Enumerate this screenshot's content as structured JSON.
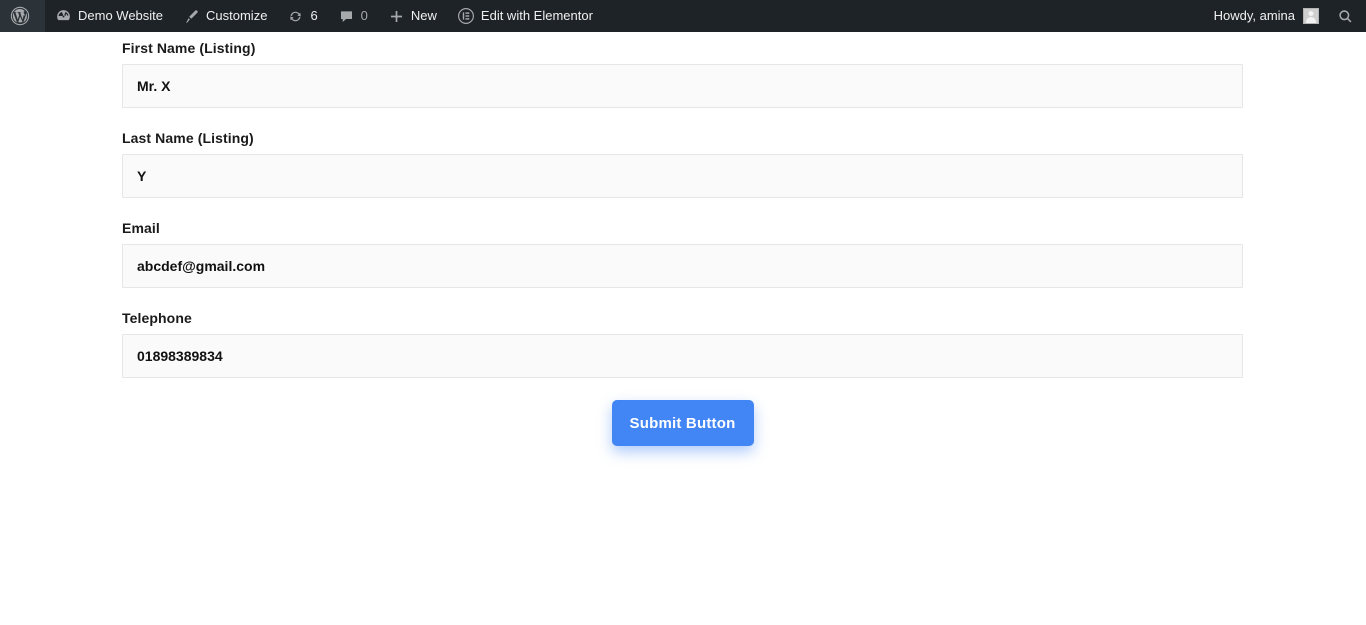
{
  "adminbar": {
    "background_color": "#1d2327",
    "left_items": [
      {
        "id": "wp-logo",
        "icon": "wordpress-logo-icon",
        "label": ""
      },
      {
        "id": "site-name",
        "icon": "dashboard-icon",
        "label": "Demo Website"
      },
      {
        "id": "customize",
        "icon": "paintbrush-icon",
        "label": "Customize"
      },
      {
        "id": "updates",
        "icon": "update-arrows-icon",
        "label": "6"
      },
      {
        "id": "comments",
        "icon": "comment-bubble-icon",
        "label": "0"
      },
      {
        "id": "new",
        "icon": "plus-icon",
        "label": "New"
      },
      {
        "id": "elementor",
        "icon": "elementor-icon",
        "label": "Edit with Elementor"
      }
    ],
    "howdy": "Howdy, amina",
    "avatar_name": "avatar",
    "search_icon": "search-icon"
  },
  "form": {
    "fields": [
      {
        "label": "First Name (Listing)",
        "value": "Mr. X",
        "placeholder": "First Name (Listing)",
        "name": "first-name-listing"
      },
      {
        "label": "Last Name (Listing)",
        "value": "Y",
        "placeholder": "Last Name (Listing)",
        "name": "last-name-listing"
      },
      {
        "label": "Email",
        "value": "abcdef@gmail.com",
        "placeholder": "Email",
        "name": "email"
      },
      {
        "label": "Telephone",
        "value": "01898389834",
        "placeholder": "Telephone",
        "name": "telephone"
      }
    ],
    "submit_label": "Submit Button",
    "submit_color": "#4285f4"
  }
}
